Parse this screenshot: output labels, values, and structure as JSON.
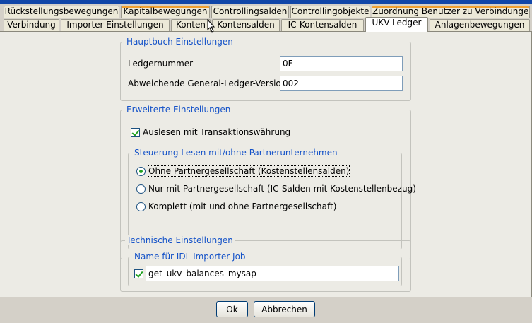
{
  "tabs_row1": [
    {
      "label": "Rückstellungsbewegungen"
    },
    {
      "label": "Kapitalbewegungen"
    },
    {
      "label": "Controllingsalden"
    },
    {
      "label": "Controllingobjekte"
    },
    {
      "label": "Zuordnung Benutzer zu Verbindungen"
    }
  ],
  "tabs_row2": [
    {
      "label": "Verbindung"
    },
    {
      "label": "Importer Einstellungen"
    },
    {
      "label": "Konten"
    },
    {
      "label": "Kontensalden"
    },
    {
      "label": "IC-Kontensalden"
    },
    {
      "label": "UKV-Ledger"
    },
    {
      "label": "Anlagenbewegungen"
    }
  ],
  "active_tab": "UKV-Ledger",
  "hauptbuch": {
    "title": "Hauptbuch Einstellungen",
    "ledgernummer_label": "Ledgernummer",
    "ledgernummer_value": "0F",
    "version_label": "Abweichende General-Ledger-Version",
    "version_value": "002"
  },
  "erweitert": {
    "title": "Erweiterte Einstellungen",
    "transaktion_label": "Auslesen mit Transaktionswährung",
    "transaktion_checked": true,
    "steuerung": {
      "title": "Steuerung Lesen mit/ohne Partnerunternehmen",
      "options": [
        {
          "label": "Ohne Partnergesellschaft (Kostenstellensalden)",
          "selected": true
        },
        {
          "label": "Nur mit Partnergesellschaft (IC-Salden mit Kostenstellenbezug)",
          "selected": false
        },
        {
          "label": "Komplett (mit und ohne Partnergesellschaft)",
          "selected": false
        }
      ]
    }
  },
  "technisch": {
    "title": "Technische Einstellungen",
    "job_group_title": "Name für IDL Importer Job",
    "job_checked": true,
    "job_value": "get_ukv_balances_mysap"
  },
  "buttons": {
    "ok": "Ok",
    "cancel": "Abbrechen"
  },
  "colors": {
    "legend_text": "#1452c8",
    "check_mark": "#21a121",
    "tab_highlight": "#f0a030"
  }
}
